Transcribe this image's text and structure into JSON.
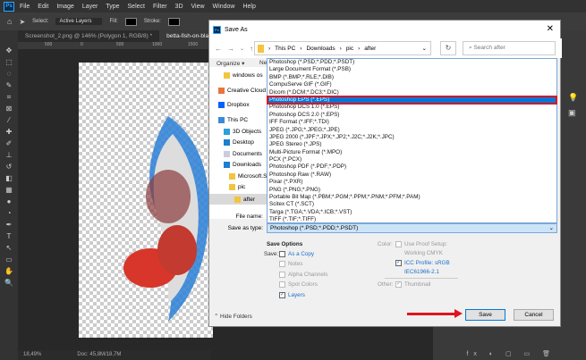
{
  "menubar": {
    "items": [
      "File",
      "Edit",
      "Image",
      "Layer",
      "Type",
      "Select",
      "Filter",
      "3D",
      "View",
      "Window",
      "Help"
    ]
  },
  "options": {
    "select_label": "Select:",
    "select_value": "Active Layers",
    "fill_label": "Fill:",
    "stroke_label": "Stroke:"
  },
  "tabs": [
    "Screenshot_2.png @ 146% (Polygon 1, RGB/8) *",
    "betta-fish-on-black-"
  ],
  "ruler": [
    "500",
    "0",
    "500",
    "1000",
    "1500"
  ],
  "status": {
    "zoom": "18,49%",
    "doc": "Doc: 45,8M/18,7M"
  },
  "dialog": {
    "title": "Save As",
    "breadcrumb": [
      "This PC",
      "Downloads",
      "pic",
      "after"
    ],
    "search_placeholder": "Search after",
    "organize": "Organize ▾",
    "new_folder": "New",
    "nav": [
      "windows os",
      "Creative Cloud",
      "Dropbox",
      "This PC",
      "3D Objects",
      "Desktop",
      "Documents",
      "Downloads",
      "Microsoft.Sk",
      "pic",
      "after"
    ],
    "file_types": [
      "Photoshop (*.PSD;*.PDD;*.PSDT)",
      "Large Document Format (*.PSB)",
      "BMP (*.BMP;*.RLE;*.DIB)",
      "CompuServe GIF (*.GIF)",
      "Dicom (*.DCM;*.DC3;*.DIC)",
      "Photoshop EPS (*.EPS)",
      "Photoshop DCS 1.0 (*.EPS)",
      "Photoshop DCS 2.0 (*.EPS)",
      "IFF Format (*.IFF;*.TDI)",
      "JPEG (*.JPG;*.JPEG;*.JPE)",
      "JPEG 2000 (*.JPF;*.JPX;*.JP2;*.J2C;*.J2K;*.JPC)",
      "JPEG Stereo (*.JPS)",
      "Multi-Picture Format (*.MPO)",
      "PCX (*.PCX)",
      "Photoshop PDF (*.PDF;*.PDP)",
      "Photoshop Raw (*.RAW)",
      "Pixar (*.PXR)",
      "PNG (*.PNG;*.PNG)",
      "Portable Bit Map (*.PBM;*.PGM;*.PPM;*.PNM;*.PFM;*.PAM)",
      "Scitex CT (*.SCT)",
      "Targa (*.TGA;*.VDA;*.ICB;*.VST)",
      "TIFF (*.TIF;*.TIFF)"
    ],
    "selected_index": 5,
    "file_name_label": "File name:",
    "save_as_type_label": "Save as type:",
    "save_as_type_value": "Photoshop (*.PSD;*.PDD;*.PSDT)",
    "save_options_title": "Save Options",
    "save_label": "Save:",
    "as_a_copy": "As a Copy",
    "notes": "Notes",
    "alpha_channels": "Alpha Channels",
    "spot_colors": "Spot Colors",
    "layers": "Layers",
    "color_label": "Color:",
    "use_proof": "Use Proof Setup:",
    "working_cmyk": "Working CMYK",
    "icc_profile": "ICC Profile:  sRGB",
    "icc_value": "IEC61966-2.1",
    "other_label": "Other:",
    "thumbnail": "Thumbnail",
    "hide_folders": "Hide Folders",
    "save_button": "Save",
    "cancel_button": "Cancel"
  },
  "colors": {
    "accent": "#0078d7",
    "highlight": "#e0141e"
  }
}
